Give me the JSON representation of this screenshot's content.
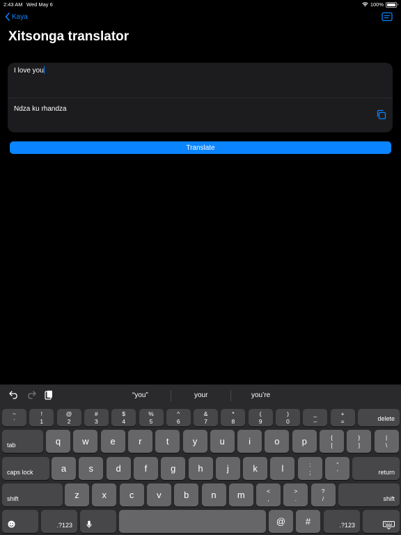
{
  "status_bar": {
    "time": "2:43 AM",
    "date": "Wed May 6",
    "battery": "100%"
  },
  "nav": {
    "back_label": "Kaya"
  },
  "page": {
    "title": "Xitsonga translator"
  },
  "input": {
    "value": "I love you"
  },
  "output": {
    "value": "Ndza ku rhandza"
  },
  "translate_button": {
    "label": "Translate"
  },
  "colors": {
    "accent": "#0a84ff",
    "background": "#000000",
    "card": "#1c1c1e",
    "key": "#666668",
    "keyboard": "#2a2a2c"
  },
  "icons": [
    "chevron-left-icon",
    "sidebar-toggle-icon",
    "copy-icon",
    "undo-icon",
    "redo-icon",
    "paste-icon",
    "emoji-icon",
    "microphone-icon",
    "hide-keyboard-icon"
  ],
  "keyboard": {
    "suggestions": [
      "“you”",
      "your",
      "you’re"
    ],
    "number_row": [
      {
        "top": "~",
        "bottom": "`"
      },
      {
        "top": "!",
        "bottom": "1"
      },
      {
        "top": "@",
        "bottom": "2"
      },
      {
        "top": "#",
        "bottom": "3"
      },
      {
        "top": "$",
        "bottom": "4"
      },
      {
        "top": "%",
        "bottom": "5"
      },
      {
        "top": "^",
        "bottom": "6"
      },
      {
        "top": "&",
        "bottom": "7"
      },
      {
        "top": "*",
        "bottom": "8"
      },
      {
        "top": "(",
        "bottom": "9"
      },
      {
        "top": ")",
        "bottom": "0"
      },
      {
        "top": "_",
        "bottom": "–"
      },
      {
        "top": "+",
        "bottom": "="
      }
    ],
    "delete": "delete",
    "tab": "tab",
    "row1": [
      "q",
      "w",
      "e",
      "r",
      "t",
      "y",
      "u",
      "i",
      "o",
      "p"
    ],
    "row1_extra": [
      {
        "top": "{",
        "bottom": "["
      },
      {
        "top": "}",
        "bottom": "]"
      },
      {
        "top": "|",
        "bottom": "\\"
      }
    ],
    "caps_lock": "caps lock",
    "row2": [
      "a",
      "s",
      "d",
      "f",
      "g",
      "h",
      "j",
      "k",
      "l"
    ],
    "row2_extra": [
      {
        "top": ":",
        "bottom": ";"
      },
      {
        "top": "”",
        "bottom": "’"
      }
    ],
    "return": "return",
    "shift_left": "shift",
    "row3": [
      "z",
      "x",
      "c",
      "v",
      "b",
      "n",
      "m"
    ],
    "row3_extra": [
      {
        "top": "<",
        "bottom": ","
      },
      {
        "top": ">",
        "bottom": "."
      },
      {
        "top": "?",
        "bottom": "/"
      }
    ],
    "shift_right": "shift",
    "numbers_left": ".?123",
    "at": "@",
    "hash": "#",
    "numbers_right": ".?123"
  }
}
